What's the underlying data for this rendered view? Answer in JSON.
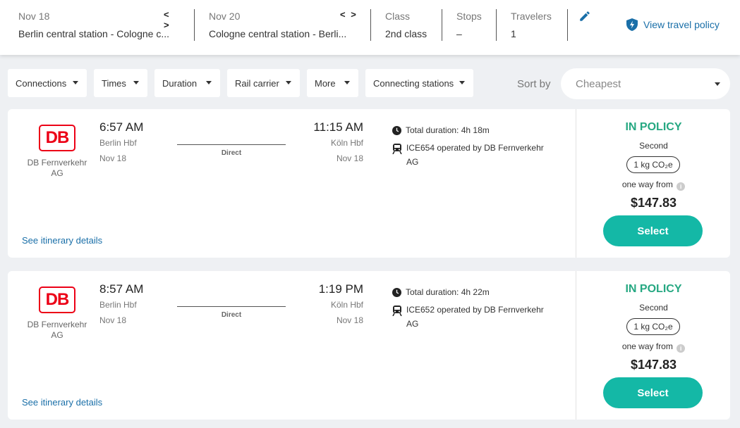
{
  "search": {
    "outbound": {
      "date": "Nov 18",
      "route": "Berlin central station - Cologne c..."
    },
    "return": {
      "date": "Nov 20",
      "route": "Cologne central station - Berli..."
    },
    "class": {
      "label": "Class",
      "value": "2nd class"
    },
    "stops": {
      "label": "Stops",
      "value": "–"
    },
    "travelers": {
      "label": "Travelers",
      "value": "1"
    },
    "arrows": "< >",
    "policy_link": "View travel policy"
  },
  "filters": [
    "Connections",
    "Times",
    "Duration",
    "Rail carrier",
    "More",
    "Connecting stations"
  ],
  "sort": {
    "label": "Sort by",
    "value": "Cheapest"
  },
  "results": [
    {
      "logo": "DB",
      "carrier": "DB Fernverkehr AG",
      "departure": {
        "time": "6:57 AM",
        "station": "Berlin Hbf",
        "date": "Nov 18"
      },
      "arrival": {
        "time": "11:15 AM",
        "station": "Köln Hbf",
        "date": "Nov 18"
      },
      "stops": "Direct",
      "duration": "Total duration: 4h 18m",
      "operator": "ICE654 operated by DB Fernverkehr AG",
      "itinerary_link": "See itinerary details",
      "policy": "IN POLICY",
      "fare_class": "Second",
      "co2": "1 kg CO₂e",
      "price_prefix": "one way from",
      "price": "$147.83",
      "select": "Select"
    },
    {
      "logo": "DB",
      "carrier": "DB Fernverkehr AG",
      "departure": {
        "time": "8:57 AM",
        "station": "Berlin Hbf",
        "date": "Nov 18"
      },
      "arrival": {
        "time": "1:19 PM",
        "station": "Köln Hbf",
        "date": "Nov 18"
      },
      "stops": "Direct",
      "duration": "Total duration: 4h 22m",
      "operator": "ICE652 operated by DB Fernverkehr AG",
      "itinerary_link": "See itinerary details",
      "policy": "IN POLICY",
      "fare_class": "Second",
      "co2": "1 kg CO₂e",
      "price_prefix": "one way from",
      "price": "$147.83",
      "select": "Select"
    }
  ],
  "colors": {
    "accent": "#14b8a6",
    "policy_green": "#26a882",
    "link_blue": "#1a6fa8",
    "db_red": "#ec0016"
  }
}
